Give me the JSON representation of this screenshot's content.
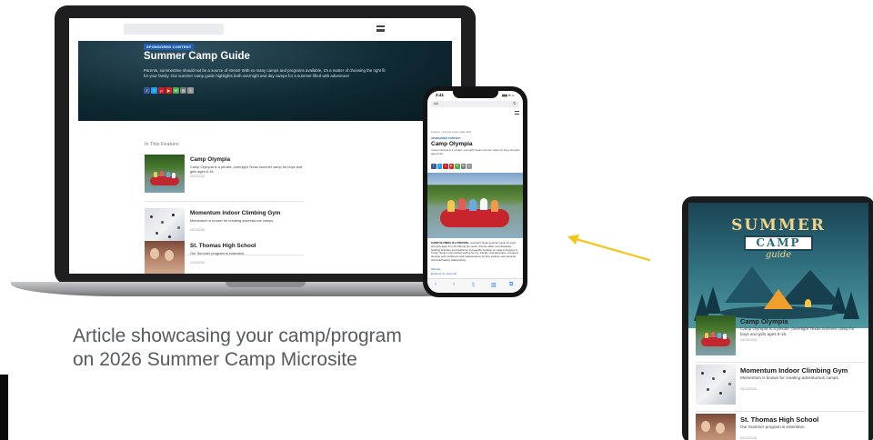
{
  "colors": {
    "accent_blue": "#1f5fb3",
    "arrow_yellow": "#f5c518",
    "caption_gray": "#555b61",
    "hero_dark": "#0f2a33"
  },
  "laptop": {
    "hero": {
      "tag": "SPONSORED CONTENT",
      "title": "Summer Camp Guide",
      "text": "Parents, summertime should not be a source of stress! With so many camps and programs available, it's a matter of choosing the right fit for your family. Our summer camp guide highlights both overnight and day camps for a summer filled with adventure!"
    },
    "share_buttons": [
      {
        "icon": "facebook-icon",
        "glyph": "f",
        "color": "#3b5998"
      },
      {
        "icon": "twitter-icon",
        "glyph": "t",
        "color": "#1da1f2"
      },
      {
        "icon": "pinterest-icon",
        "glyph": "p",
        "color": "#cb2027"
      },
      {
        "icon": "youtube-icon",
        "glyph": "▶",
        "color": "#e62117"
      },
      {
        "icon": "email-icon",
        "glyph": "✉",
        "color": "#4caf50"
      },
      {
        "icon": "print-icon",
        "glyph": "▤",
        "color": "#7a7a7a"
      },
      {
        "icon": "share-icon",
        "glyph": "+",
        "color": "#9a9a9a"
      }
    ],
    "in_this_feature": "In This Feature:",
    "features": [
      {
        "title": "Camp Olympia",
        "desc": "Camp Olympia is a private, overnight Texas summer camp for boys and girls ages 6-16.",
        "date": "03/13/2026"
      },
      {
        "title": "Momentum Indoor Climbing Gym",
        "desc": "Momentum is known for creating adventurous camps.",
        "date": "03/13/2026"
      },
      {
        "title": "St. Thomas High School",
        "desc": "Our Summer program is extensive.",
        "date": "03/13/2026"
      }
    ]
  },
  "phone": {
    "time": "3:41",
    "signal": "▮▮▮ ≋ ▭",
    "url_aa": "AA",
    "reload": "↻",
    "breadcrumb": "Features › Summer Camp Guide 2026",
    "sponsored": "SPONSORED CONTENT",
    "title": "Camp Olympia",
    "desc": "Camp Olympia is a private, overnight Texas summer camp for boys and girls ages 6-16.",
    "body_lead": "CAMP OLYMPIA IS A PRIVATE,",
    "body": "overnight Texas summer camp for boys and girls ages 6 to 16 offering top-notch, diverse skills, and character-building activities and traditions. Its beautiful location on Lake Livingston in Trinity, Texas is the perfect setting for fun, friends, and adventure. Campers develop self-confidence and independence as they explore new interests and build lasting relationships.",
    "link1": "Website",
    "link2": "Email us for more info",
    "toolbar": [
      "‹",
      "›",
      "⇪",
      "▥",
      "⧉"
    ]
  },
  "caption": {
    "line1": "Article showcasing your camp/program",
    "line2": "on 2026 Summer Camp Microsite"
  },
  "tablet": {
    "banner_summer": "SUMMER",
    "banner_camp": "CAMP",
    "banner_guide": "guide",
    "features": [
      {
        "title": "Camp Olympia",
        "desc": "Camp Olympia is a private, overnight Texas summer camp for boys and girls ages 6-16.",
        "date": "03/13/2026"
      },
      {
        "title": "Momentum Indoor Climbing Gym",
        "desc": "Momentum is known for creating adventurous camps.",
        "date": "03/13/2026"
      },
      {
        "title": "St. Thomas High School",
        "desc": "Our Summer program is extensive.",
        "date": "03/13/2026"
      }
    ]
  }
}
